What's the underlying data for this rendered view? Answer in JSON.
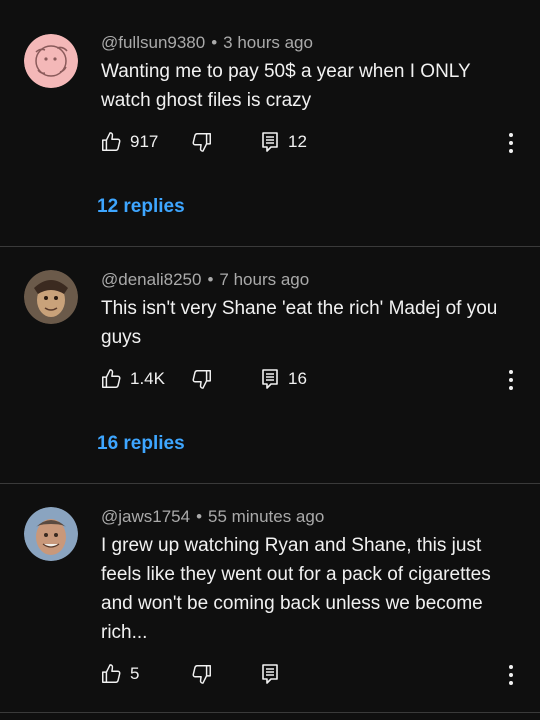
{
  "comments": [
    {
      "handle": "@fullsun9380",
      "time": "3 hours ago",
      "text_lines": [
        "Wanting me to pay 50$ a year when I ONLY",
        "watch ghost files is crazy"
      ],
      "likes": "917",
      "reply_count": "12",
      "replies_link": "12 replies",
      "avatar_colors": {
        "bg": "#f4b8b8",
        "stroke": "#8a5a5a"
      }
    },
    {
      "handle": "@denali8250",
      "time": "7 hours ago",
      "text_lines": [
        "This isn't very Shane 'eat the rich' Madej of you",
        "guys"
      ],
      "likes": "1.4K",
      "reply_count": "16",
      "replies_link": "16 replies",
      "avatar_colors": {
        "bg": "#6b5a4a",
        "stroke": "#c9a27a"
      }
    },
    {
      "handle": "@jaws1754",
      "time": "55 minutes ago",
      "text_lines": [
        "I grew up watching Ryan and Shane, this just",
        "feels like they went out for a pack of cigarettes",
        "and won't be coming back unless we become",
        "rich..."
      ],
      "likes": "5",
      "reply_count": "",
      "replies_link": "",
      "avatar_colors": {
        "bg": "#c9987a",
        "stroke": "#5a3a2a"
      }
    }
  ],
  "separator": "•",
  "icons": [
    "like-icon",
    "dislike-icon",
    "reply-icon",
    "more-options-icon"
  ],
  "colors": {
    "background": "#0f0f0f",
    "link": "#3ea6ff",
    "meta": "#aaaaaa",
    "divider": "#3a3a3a"
  }
}
